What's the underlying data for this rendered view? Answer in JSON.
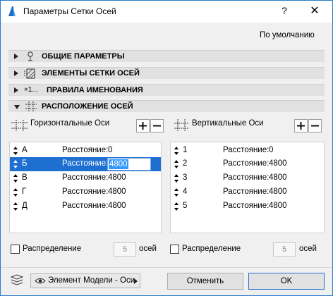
{
  "window": {
    "title": "Параметры Сетки Осей",
    "help_glyph": "?",
    "close_glyph": "✕",
    "defaults_label": "По умолчанию"
  },
  "sections": [
    {
      "label": "ОБЩИЕ ПАРАМЕТРЫ",
      "icon": "pin-icon",
      "expanded": false
    },
    {
      "label": "ЭЛЕМЕНТЫ СЕТКИ ОСЕЙ",
      "icon": "grid-element-icon",
      "expanded": false
    },
    {
      "label": "ПРАВИЛА ИМЕНОВАНИЯ",
      "icon": "naming-icon",
      "icon_text": "×1...",
      "expanded": false
    },
    {
      "label": "РАСПОЛОЖЕНИЕ ОСЕЙ",
      "icon": "grid-placement-icon",
      "expanded": true
    }
  ],
  "horizontal": {
    "title": "Горизонтальные Оси",
    "rows": [
      {
        "name": "А",
        "label": "Расстояние:",
        "value": "0"
      },
      {
        "name": "Б",
        "label": "Расстояние:",
        "value": "4800"
      },
      {
        "name": "В",
        "label": "Расстояние:",
        "value": "4800"
      },
      {
        "name": "Г",
        "label": "Расстояние:",
        "value": "4800"
      },
      {
        "name": "Д",
        "label": "Расстояние:",
        "value": "4800"
      }
    ],
    "selected_index": 1,
    "distribution_label": "Распределение",
    "distribution_count": "5",
    "distribution_unit": "осей"
  },
  "vertical": {
    "title": "Вертикальные Оси",
    "rows": [
      {
        "name": "1",
        "label": "Расстояние:",
        "value": "0"
      },
      {
        "name": "2",
        "label": "Расстояние:",
        "value": "4800"
      },
      {
        "name": "3",
        "label": "Расстояние:",
        "value": "4800"
      },
      {
        "name": "4",
        "label": "Расстояние:",
        "value": "4800"
      },
      {
        "name": "5",
        "label": "Расстояние:",
        "value": "4800"
      }
    ],
    "distribution_label": "Распределение",
    "distribution_count": "5",
    "distribution_unit": "осей"
  },
  "footer": {
    "layer_label": "Элемент Модели - Оси",
    "cancel_label": "Отменить",
    "ok_label": "OK"
  },
  "colors": {
    "selection": "#1f6fd1",
    "window_border": "#2b79d0",
    "section_bg": "#e1e1e1"
  }
}
